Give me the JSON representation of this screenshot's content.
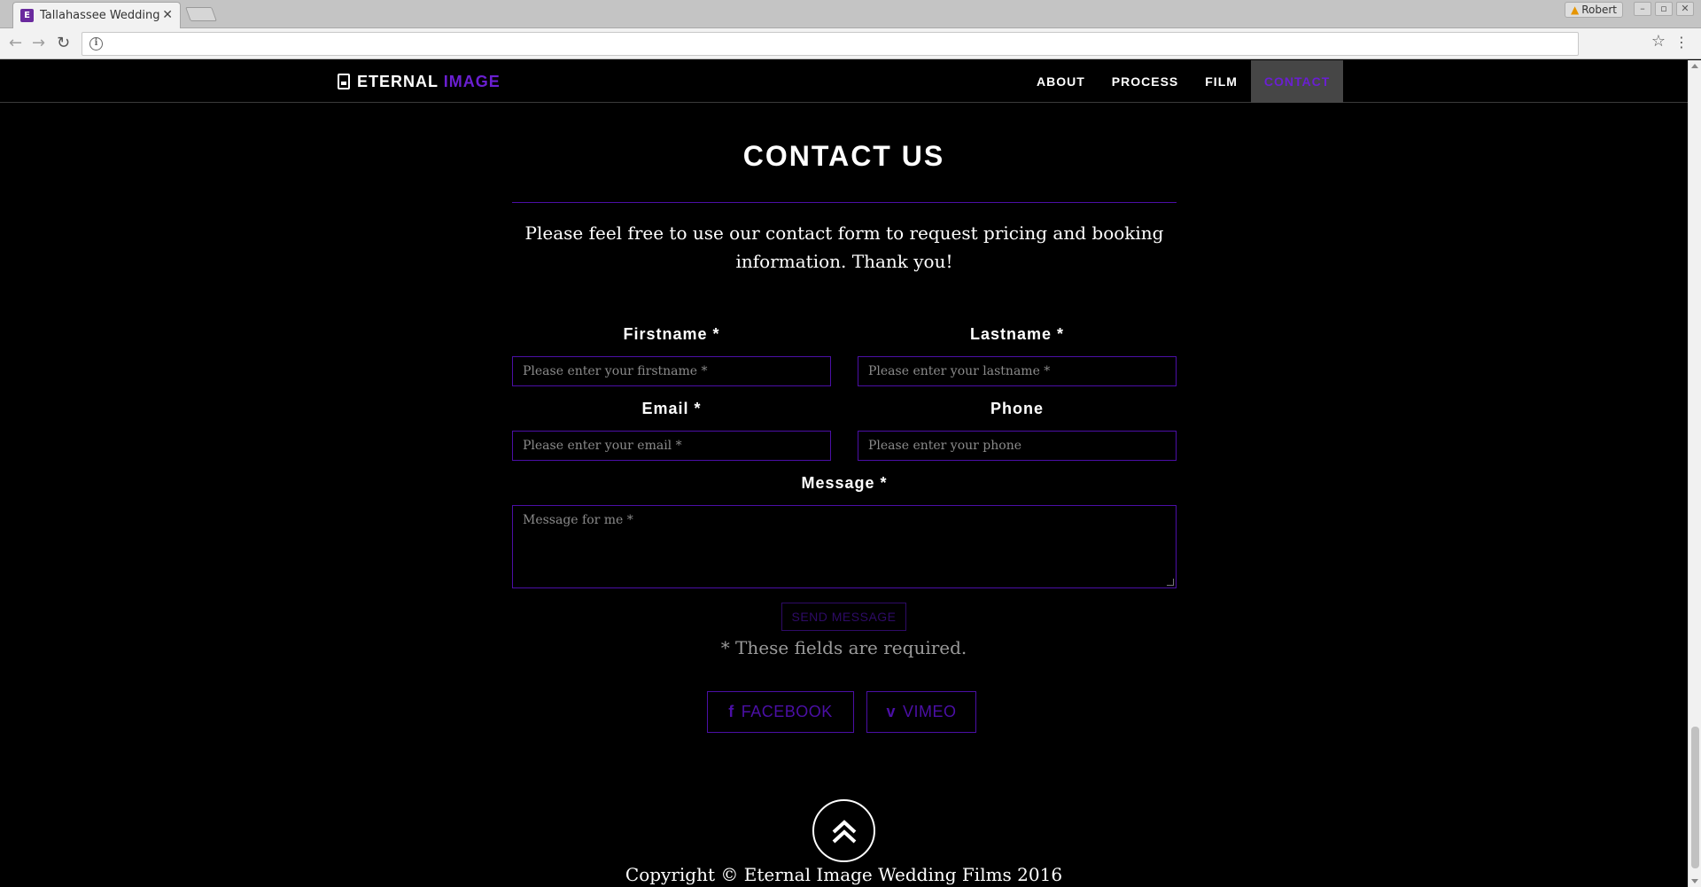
{
  "browser": {
    "tab_title": "Tallahassee Wedding F",
    "tab_favicon": "E",
    "profile_name": "Robert",
    "url": ""
  },
  "nav": {
    "brand_first": "ETERNAL",
    "brand_second": "IMAGE",
    "links": [
      "ABOUT",
      "PROCESS",
      "FILM",
      "CONTACT"
    ],
    "active": "CONTACT"
  },
  "contact": {
    "heading": "CONTACT US",
    "intro": "Please feel free to use our contact form to request pricing and booking information. Thank you!",
    "fields": {
      "firstname": {
        "label": "Firstname *",
        "placeholder": "Please enter your firstname *"
      },
      "lastname": {
        "label": "Lastname *",
        "placeholder": "Please enter your lastname *"
      },
      "email": {
        "label": "Email *",
        "placeholder": "Please enter your email *"
      },
      "phone": {
        "label": "Phone",
        "placeholder": "Please enter your phone"
      },
      "message": {
        "label": "Message *",
        "placeholder": "Message for me *"
      }
    },
    "send_label": "SEND MESSAGE",
    "required_note": "* These fields are required."
  },
  "social": {
    "facebook": {
      "icon": "f",
      "label": "FACEBOOK"
    },
    "vimeo": {
      "icon": "v",
      "label": "VIMEO"
    }
  },
  "footer": {
    "copyright": "Copyright © Eternal Image Wedding Films 2016"
  },
  "colors": {
    "accent": "#6a1fd1",
    "border_accent": "#4b0fa6",
    "background": "#000000"
  },
  "icons": [
    "back-icon",
    "forward-icon",
    "reload-icon",
    "info-icon",
    "star-icon",
    "menu-icon",
    "document-icon",
    "facebook-icon",
    "vimeo-icon",
    "double-chevron-up-icon"
  ]
}
